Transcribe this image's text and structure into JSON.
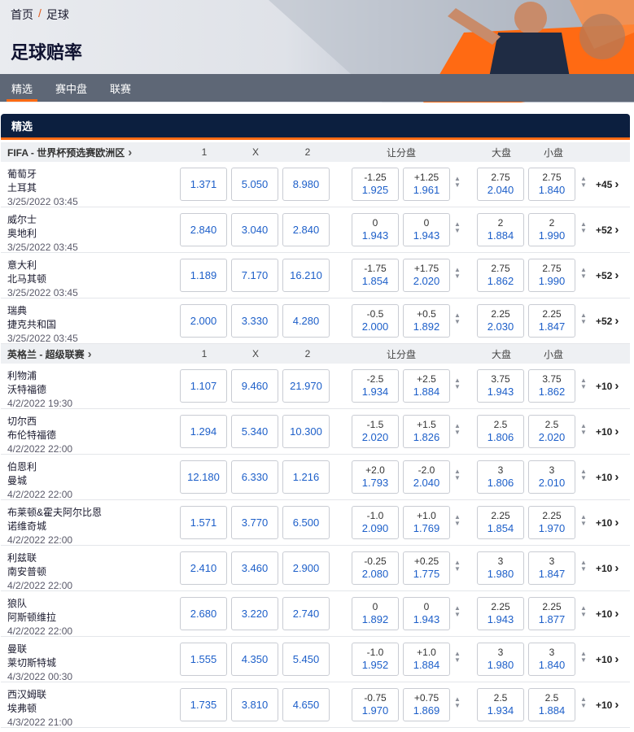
{
  "breadcrumb": {
    "home": "首页",
    "separator": "/",
    "current": "足球"
  },
  "page_title": "足球赔率",
  "tabs": [
    "精选",
    "赛中盘",
    "联赛"
  ],
  "section_title": "精选",
  "colors": {
    "accent": "#ff6a13",
    "header_bg": "#0c1f3f",
    "odds_blue": "#1d5fc9",
    "tab_bar": "#5e6776"
  },
  "columns": {
    "c1": "1",
    "cx": "X",
    "c2": "2",
    "handicap": "让分盘",
    "over": "大盘",
    "under": "小盘"
  },
  "leagues": [
    {
      "name": "FIFA - 世界杯预选赛欧洲区",
      "matches": [
        {
          "home": "葡萄牙",
          "away": "土耳其",
          "time": "3/25/2022 03:45",
          "o1": "1.371",
          "ox": "5.050",
          "o2": "8.980",
          "h1l": "-1.25",
          "h1p": "1.925",
          "h2l": "+1.25",
          "h2p": "1.961",
          "ovl": "2.75",
          "ovp": "2.040",
          "unl": "2.75",
          "unp": "1.840",
          "more": "+45"
        },
        {
          "home": "威尔士",
          "away": "奥地利",
          "time": "3/25/2022 03:45",
          "o1": "2.840",
          "ox": "3.040",
          "o2": "2.840",
          "h1l": "0",
          "h1p": "1.943",
          "h2l": "0",
          "h2p": "1.943",
          "ovl": "2",
          "ovp": "1.884",
          "unl": "2",
          "unp": "1.990",
          "more": "+52"
        },
        {
          "home": "意大利",
          "away": "北马其顿",
          "time": "3/25/2022 03:45",
          "o1": "1.189",
          "ox": "7.170",
          "o2": "16.210",
          "h1l": "-1.75",
          "h1p": "1.854",
          "h2l": "+1.75",
          "h2p": "2.020",
          "ovl": "2.75",
          "ovp": "1.862",
          "unl": "2.75",
          "unp": "1.990",
          "more": "+52"
        },
        {
          "home": "瑞典",
          "away": "捷克共和国",
          "time": "3/25/2022 03:45",
          "o1": "2.000",
          "ox": "3.330",
          "o2": "4.280",
          "h1l": "-0.5",
          "h1p": "2.000",
          "h2l": "+0.5",
          "h2p": "1.892",
          "ovl": "2.25",
          "ovp": "2.030",
          "unl": "2.25",
          "unp": "1.847",
          "more": "+52"
        }
      ]
    },
    {
      "name": "英格兰 - 超级联赛",
      "matches": [
        {
          "home": "利物浦",
          "away": "沃特福德",
          "time": "4/2/2022 19:30",
          "o1": "1.107",
          "ox": "9.460",
          "o2": "21.970",
          "h1l": "-2.5",
          "h1p": "1.934",
          "h2l": "+2.5",
          "h2p": "1.884",
          "ovl": "3.75",
          "ovp": "1.943",
          "unl": "3.75",
          "unp": "1.862",
          "more": "+10"
        },
        {
          "home": "切尔西",
          "away": "布伦特福德",
          "time": "4/2/2022 22:00",
          "o1": "1.294",
          "ox": "5.340",
          "o2": "10.300",
          "h1l": "-1.5",
          "h1p": "2.020",
          "h2l": "+1.5",
          "h2p": "1.826",
          "ovl": "2.5",
          "ovp": "1.806",
          "unl": "2.5",
          "unp": "2.020",
          "more": "+10"
        },
        {
          "home": "伯恩利",
          "away": "曼城",
          "time": "4/2/2022 22:00",
          "o1": "12.180",
          "ox": "6.330",
          "o2": "1.216",
          "h1l": "+2.0",
          "h1p": "1.793",
          "h2l": "-2.0",
          "h2p": "2.040",
          "ovl": "3",
          "ovp": "1.806",
          "unl": "3",
          "unp": "2.010",
          "more": "+10"
        },
        {
          "home": "布莱顿&霍夫阿尔比恩",
          "away": "诺维奇城",
          "time": "4/2/2022 22:00",
          "o1": "1.571",
          "ox": "3.770",
          "o2": "6.500",
          "h1l": "-1.0",
          "h1p": "2.090",
          "h2l": "+1.0",
          "h2p": "1.769",
          "ovl": "2.25",
          "ovp": "1.854",
          "unl": "2.25",
          "unp": "1.970",
          "more": "+10"
        },
        {
          "home": "利兹联",
          "away": "南安普顿",
          "time": "4/2/2022 22:00",
          "o1": "2.410",
          "ox": "3.460",
          "o2": "2.900",
          "h1l": "-0.25",
          "h1p": "2.080",
          "h2l": "+0.25",
          "h2p": "1.775",
          "ovl": "3",
          "ovp": "1.980",
          "unl": "3",
          "unp": "1.847",
          "more": "+10"
        },
        {
          "home": "狼队",
          "away": "阿斯顿维拉",
          "time": "4/2/2022 22:00",
          "o1": "2.680",
          "ox": "3.220",
          "o2": "2.740",
          "h1l": "0",
          "h1p": "1.892",
          "h2l": "0",
          "h2p": "1.943",
          "ovl": "2.25",
          "ovp": "1.943",
          "unl": "2.25",
          "unp": "1.877",
          "more": "+10"
        },
        {
          "home": "曼联",
          "away": "莱切斯特城",
          "time": "4/3/2022 00:30",
          "o1": "1.555",
          "ox": "4.350",
          "o2": "5.450",
          "h1l": "-1.0",
          "h1p": "1.952",
          "h2l": "+1.0",
          "h2p": "1.884",
          "ovl": "3",
          "ovp": "1.980",
          "unl": "3",
          "unp": "1.840",
          "more": "+10"
        },
        {
          "home": "西汉姆联",
          "away": "埃弗顿",
          "time": "4/3/2022 21:00",
          "o1": "1.735",
          "ox": "3.810",
          "o2": "4.650",
          "h1l": "-0.75",
          "h1p": "1.970",
          "h2l": "+0.75",
          "h2p": "1.869",
          "ovl": "2.5",
          "ovp": "1.934",
          "unl": "2.5",
          "unp": "1.884",
          "more": "+10"
        }
      ]
    }
  ]
}
